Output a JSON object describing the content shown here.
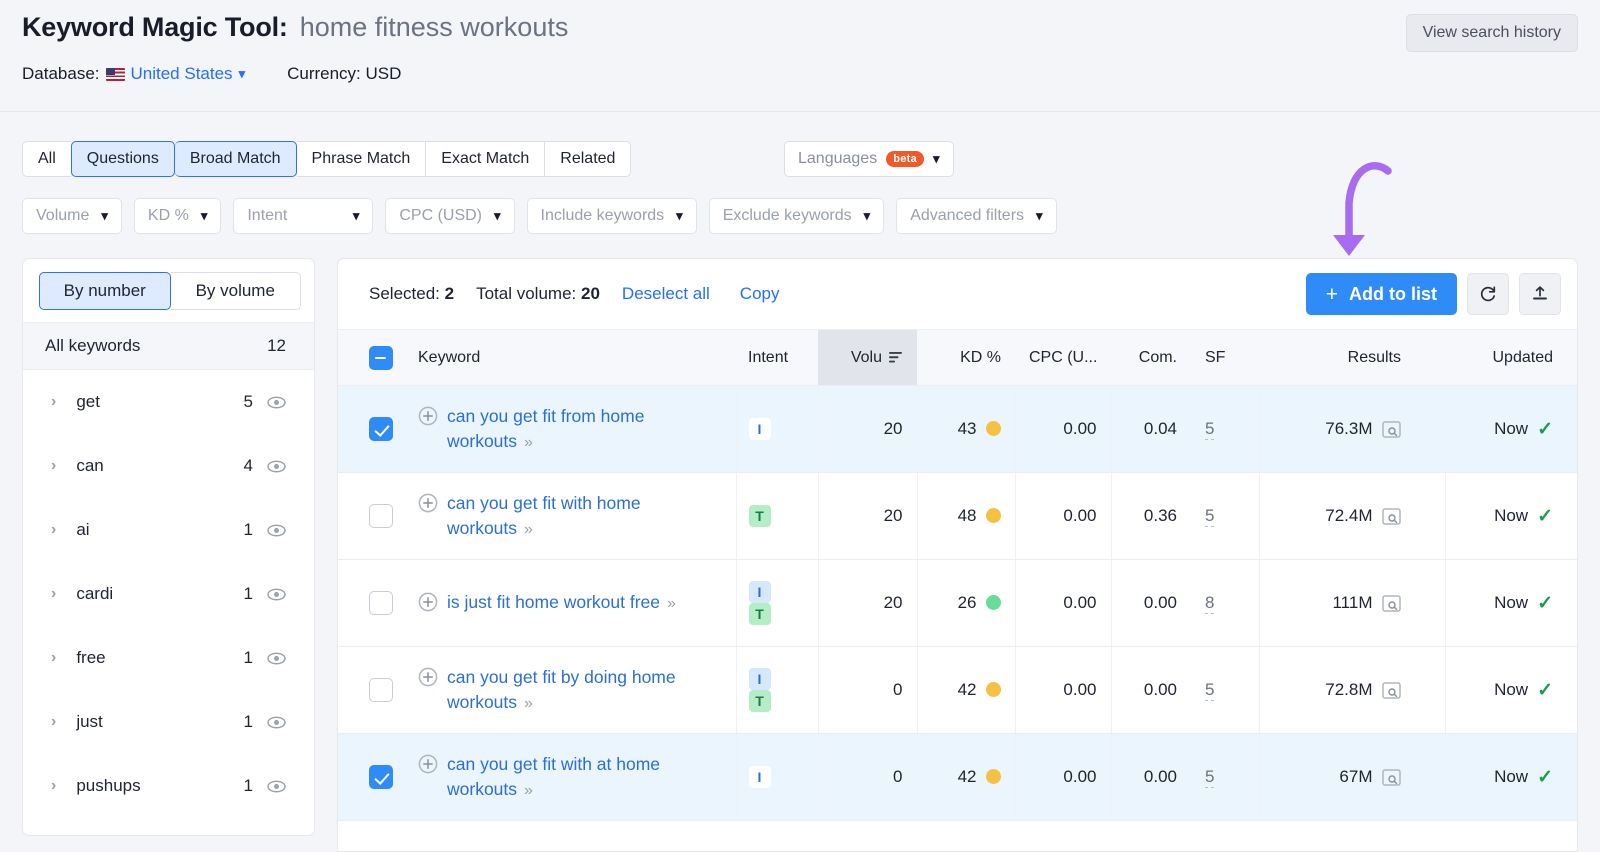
{
  "header": {
    "title_label": "Keyword Magic Tool:",
    "query": "home fitness workouts",
    "database_label": "Database:",
    "database_value": "United States",
    "currency_label": "Currency: USD",
    "view_history_label": "View search history"
  },
  "filters": {
    "match_tabs": [
      {
        "label": "All",
        "active": false
      },
      {
        "label": "Questions",
        "active": true
      },
      {
        "label": "Broad Match",
        "active": true
      },
      {
        "label": "Phrase Match",
        "active": false
      },
      {
        "label": "Exact Match",
        "active": false
      },
      {
        "label": "Related",
        "active": false
      }
    ],
    "languages_label": "Languages",
    "languages_badge": "beta",
    "dropdowns": [
      {
        "label": "Volume"
      },
      {
        "label": "KD %"
      },
      {
        "label": "Intent"
      },
      {
        "label": "CPC (USD)"
      },
      {
        "label": "Include keywords"
      },
      {
        "label": "Exclude keywords"
      },
      {
        "label": "Advanced filters"
      }
    ]
  },
  "sidebar": {
    "segment": [
      {
        "label": "By number",
        "active": true
      },
      {
        "label": "By volume",
        "active": false
      }
    ],
    "all_keywords_label": "All keywords",
    "all_keywords_count": "12",
    "items": [
      {
        "label": "get",
        "count": "5"
      },
      {
        "label": "can",
        "count": "4"
      },
      {
        "label": "ai",
        "count": "1"
      },
      {
        "label": "cardi",
        "count": "1"
      },
      {
        "label": "free",
        "count": "1"
      },
      {
        "label": "just",
        "count": "1"
      },
      {
        "label": "pushups",
        "count": "1"
      }
    ]
  },
  "toolbar": {
    "selected_label": "Selected:",
    "selected_count": "2",
    "total_volume_label": "Total volume:",
    "total_volume_value": "20",
    "deselect_all_label": "Deselect all",
    "copy_label": "Copy",
    "add_to_list_label": "Add to list",
    "add_icon": "plus-icon",
    "refresh_icon": "refresh-icon",
    "export_icon": "export-icon"
  },
  "table": {
    "columns": [
      {
        "key": "check",
        "label": ""
      },
      {
        "key": "keyword",
        "label": "Keyword"
      },
      {
        "key": "intent",
        "label": "Intent"
      },
      {
        "key": "volume",
        "label": "Volu",
        "sorted": true
      },
      {
        "key": "kd",
        "label": "KD %"
      },
      {
        "key": "cpc",
        "label": "CPC (U..."
      },
      {
        "key": "com",
        "label": "Com."
      },
      {
        "key": "sf",
        "label": "SF"
      },
      {
        "key": "results",
        "label": "Results"
      },
      {
        "key": "updated",
        "label": "Updated"
      }
    ],
    "header_checkbox_state": "indeterminate",
    "rows": [
      {
        "selected": true,
        "keyword": "can you get fit from home workouts",
        "intent": [
          {
            "code": "I",
            "type": "informational-white"
          }
        ],
        "volume": "20",
        "kd": "43",
        "kd_color": "#f5c145",
        "cpc": "0.00",
        "com": "0.04",
        "sf": "5",
        "results": "76.3M",
        "updated": "Now"
      },
      {
        "selected": false,
        "keyword": "can you get fit with home workouts",
        "intent": [
          {
            "code": "T",
            "type": "transactional"
          }
        ],
        "volume": "20",
        "kd": "48",
        "kd_color": "#f5c145",
        "cpc": "0.00",
        "com": "0.36",
        "sf": "5",
        "results": "72.4M",
        "updated": "Now"
      },
      {
        "selected": false,
        "keyword": "is just fit home workout free",
        "intent": [
          {
            "code": "I",
            "type": "informational"
          },
          {
            "code": "T",
            "type": "transactional"
          }
        ],
        "volume": "20",
        "kd": "26",
        "kd_color": "#66dd9b",
        "cpc": "0.00",
        "com": "0.00",
        "sf": "8",
        "results": "111M",
        "updated": "Now"
      },
      {
        "selected": false,
        "keyword": "can you get fit by doing home workouts",
        "intent": [
          {
            "code": "I",
            "type": "informational"
          },
          {
            "code": "T",
            "type": "transactional"
          }
        ],
        "volume": "0",
        "kd": "42",
        "kd_color": "#f5c145",
        "cpc": "0.00",
        "com": "0.00",
        "sf": "5",
        "results": "72.8M",
        "updated": "Now"
      },
      {
        "selected": true,
        "keyword": "can you get fit with at home workouts",
        "intent": [
          {
            "code": "I",
            "type": "informational-white"
          }
        ],
        "volume": "0",
        "kd": "42",
        "kd_color": "#f5c145",
        "cpc": "0.00",
        "com": "0.00",
        "sf": "5",
        "results": "67M",
        "updated": "Now"
      }
    ]
  },
  "annotation": {
    "arrow_color": "#a86cf0",
    "points_to": "add-to-list-button"
  },
  "colors": {
    "accent_blue": "#2f8bf5",
    "link_blue": "#256eff",
    "selected_row": "#eaf5fd",
    "beta_orange": "#f05a28",
    "kd_yellow": "#f5c145",
    "kd_green": "#66dd9b",
    "check_green": "#1a9e4b"
  }
}
